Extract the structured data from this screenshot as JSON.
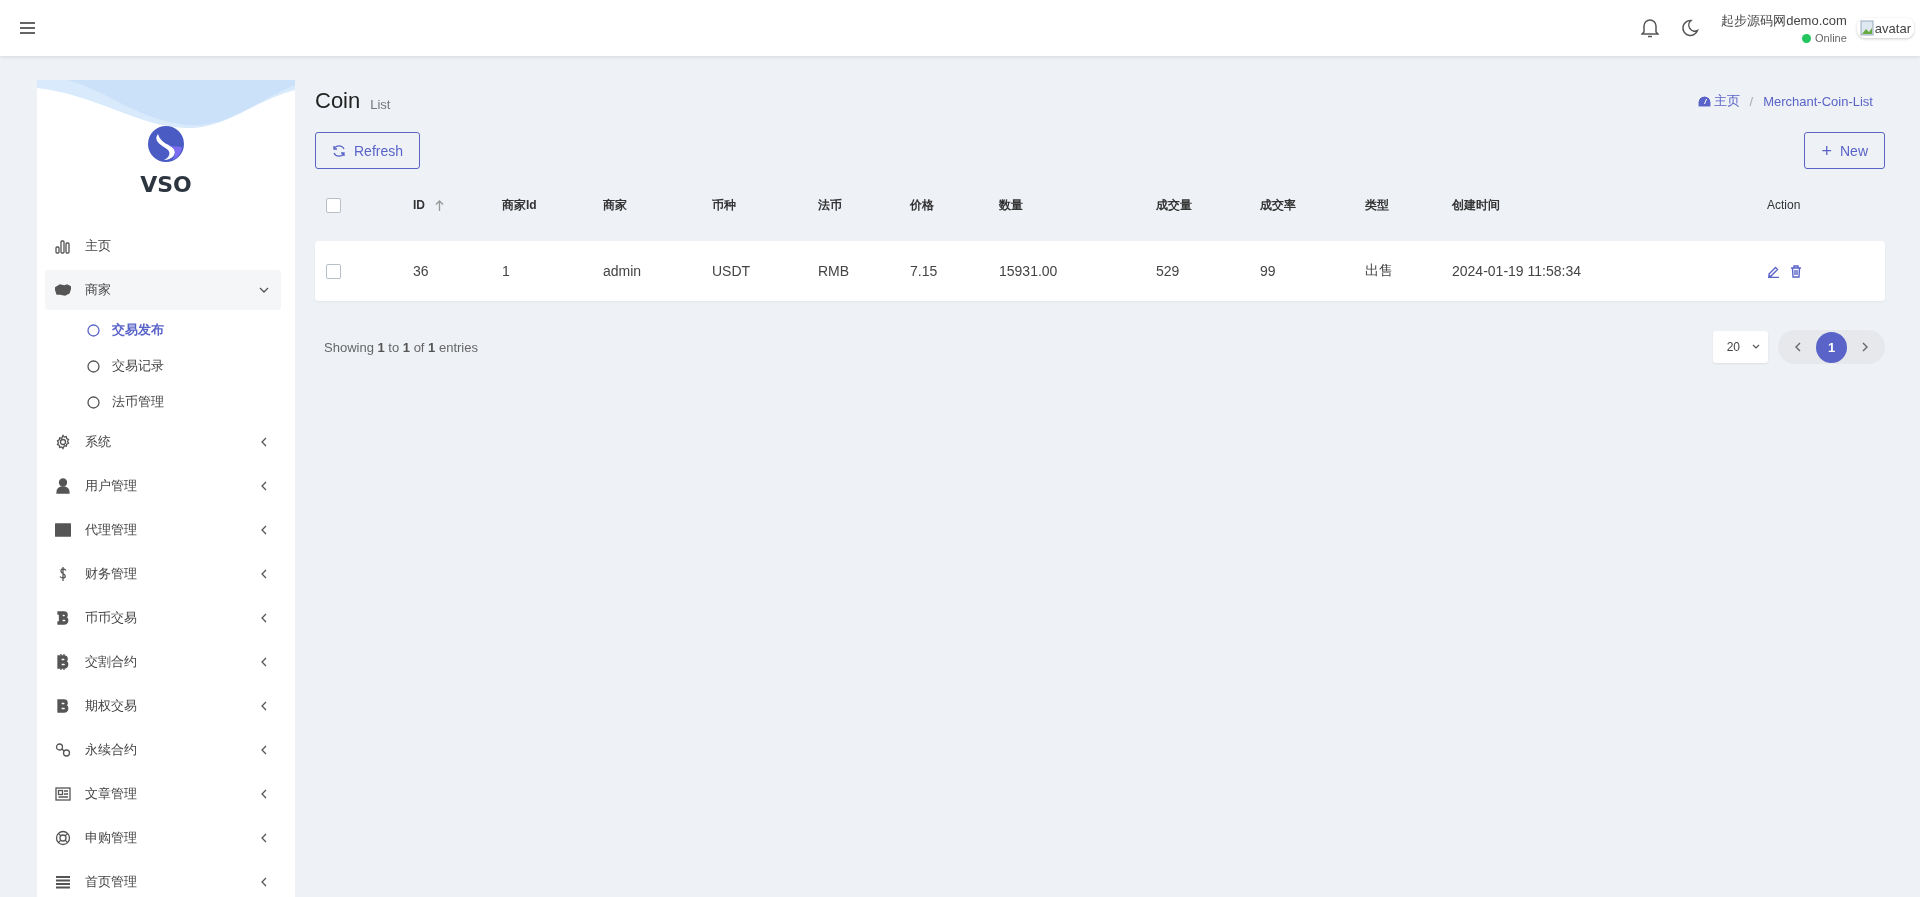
{
  "header": {
    "user_name": "起步源码网demo.com",
    "status": "Online",
    "avatar_alt": "avatar"
  },
  "sidebar": {
    "brand": "VSO",
    "items": [
      {
        "label": "主页",
        "kind": "link"
      },
      {
        "label": "商家",
        "kind": "group",
        "expanded": true,
        "children": [
          {
            "label": "交易发布",
            "selected": true
          },
          {
            "label": "交易记录",
            "selected": false
          },
          {
            "label": "法币管理",
            "selected": false
          }
        ]
      },
      {
        "label": "系统",
        "kind": "group",
        "expanded": false
      },
      {
        "label": "用户管理",
        "kind": "group",
        "expanded": false
      },
      {
        "label": "代理管理",
        "kind": "group",
        "expanded": false
      },
      {
        "label": "财务管理",
        "kind": "group",
        "expanded": false
      },
      {
        "label": "币币交易",
        "kind": "group",
        "expanded": false
      },
      {
        "label": "交割合约",
        "kind": "group",
        "expanded": false
      },
      {
        "label": "期权交易",
        "kind": "group",
        "expanded": false
      },
      {
        "label": "永续合约",
        "kind": "group",
        "expanded": false
      },
      {
        "label": "文章管理",
        "kind": "group",
        "expanded": false
      },
      {
        "label": "申购管理",
        "kind": "group",
        "expanded": false
      },
      {
        "label": "首页管理",
        "kind": "group",
        "expanded": false
      }
    ]
  },
  "page": {
    "title": "Coin",
    "subtitle": "List",
    "breadcrumb": [
      {
        "label": "主页"
      },
      {
        "label": "Merchant-Coin-List"
      }
    ],
    "breadcrumb_separator": "/"
  },
  "buttons": {
    "refresh": "Refresh",
    "new_plus": "+",
    "new": "New"
  },
  "table": {
    "select_all_checked": false,
    "columns": [
      "ID",
      "商家Id",
      "商家",
      "币种",
      "法币",
      "价格",
      "数量",
      "成交量",
      "成交率",
      "类型",
      "创建时间",
      "Action"
    ],
    "rows": [
      {
        "checked": false,
        "cells": [
          "36",
          "1",
          "admin",
          "USDT",
          "RMB",
          "7.15",
          "15931.00",
          "529",
          "99",
          "出售",
          "2024-01-19 11:58:34"
        ]
      }
    ]
  },
  "footer": {
    "showing": "Showing **1** to **1** of **1** entries",
    "page_size": "20",
    "pages": [
      {
        "label": "1",
        "selected": true
      }
    ]
  }
}
